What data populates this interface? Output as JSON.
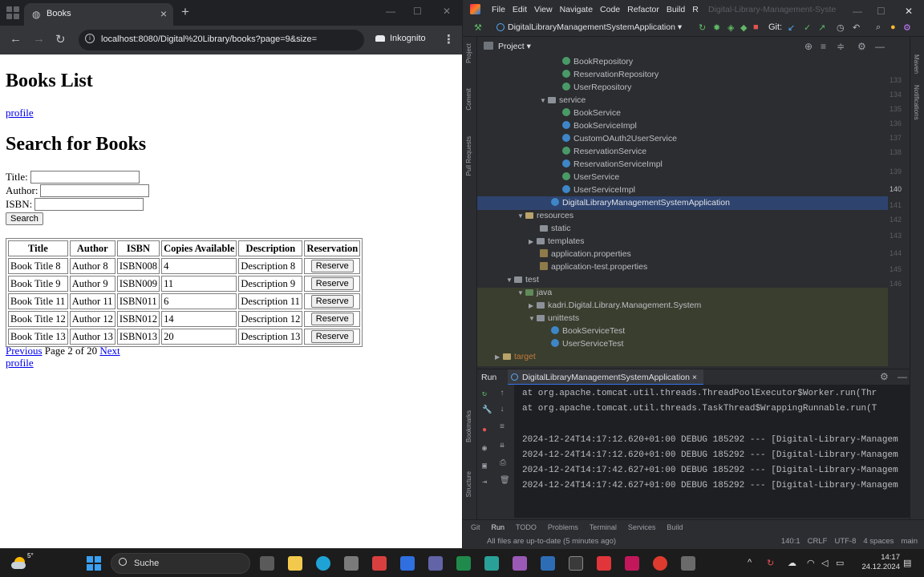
{
  "browser": {
    "tab_title": "Books",
    "url": "localhost:8080/Digital%20Library/books?page=9&size=",
    "incognito_label": "Inkognito"
  },
  "page": {
    "heading": "Books List",
    "profile_link": "profile",
    "search_heading": "Search for Books",
    "form": {
      "title_label": "Title:",
      "author_label": "Author:",
      "isbn_label": "ISBN:",
      "search_button": "Search"
    },
    "table": {
      "headers": [
        "Title",
        "Author",
        "ISBN",
        "Copies Available",
        "Description",
        "Reservation"
      ],
      "rows": [
        [
          "Book Title 8",
          "Author 8",
          "ISBN008",
          "4",
          "Description 8",
          "Reserve"
        ],
        [
          "Book Title 9",
          "Author 9",
          "ISBN009",
          "11",
          "Description 9",
          "Reserve"
        ],
        [
          "Book Title 11",
          "Author 11",
          "ISBN011",
          "6",
          "Description 11",
          "Reserve"
        ],
        [
          "Book Title 12",
          "Author 12",
          "ISBN012",
          "14",
          "Description 12",
          "Reserve"
        ],
        [
          "Book Title 13",
          "Author 13",
          "ISBN013",
          "20",
          "Description 13",
          "Reserve"
        ]
      ]
    },
    "pager": {
      "previous": "Previous",
      "info": "Page 2 of 20",
      "next": "Next"
    },
    "profile_link_bottom": "profile"
  },
  "ide": {
    "menu": [
      "File",
      "Edit",
      "View",
      "Navigate",
      "Code",
      "Refactor",
      "Build"
    ],
    "menu_extra": "R",
    "window_title": "Digital-Library-Management-Syste",
    "run_config": "DigitalLibraryManagementSystemApplication",
    "git_label": "Git:",
    "project_label": "Project",
    "tree": [
      {
        "label": "BookRepository",
        "kind": "iface"
      },
      {
        "label": "ReservationRepository",
        "kind": "iface"
      },
      {
        "label": "UserRepository",
        "kind": "iface"
      },
      {
        "label": "service",
        "kind": "folder"
      },
      {
        "label": "BookService",
        "kind": "iface"
      },
      {
        "label": "BookServiceImpl",
        "kind": "class"
      },
      {
        "label": "CustomOAuth2UserService",
        "kind": "class"
      },
      {
        "label": "ReservationService",
        "kind": "iface"
      },
      {
        "label": "ReservationServiceImpl",
        "kind": "class"
      },
      {
        "label": "UserService",
        "kind": "iface"
      },
      {
        "label": "UserServiceImpl",
        "kind": "class"
      },
      {
        "label": "DigitalLibraryManagementSystemApplication",
        "kind": "class"
      },
      {
        "label": "resources",
        "kind": "res"
      },
      {
        "label": "static",
        "kind": "folder"
      },
      {
        "label": "templates",
        "kind": "folder"
      },
      {
        "label": "application.properties",
        "kind": "props"
      },
      {
        "label": "application-test.properties",
        "kind": "props"
      },
      {
        "label": "test",
        "kind": "folder"
      },
      {
        "label": "java",
        "kind": "test"
      },
      {
        "label": "kadri.Digital.Library.Management.System",
        "kind": "folder"
      },
      {
        "label": "unittests",
        "kind": "folder"
      },
      {
        "label": "BookServiceTest",
        "kind": "class"
      },
      {
        "label": "UserServiceTest",
        "kind": "class"
      },
      {
        "label": "target",
        "kind": "res"
      }
    ],
    "gutter": [
      "133",
      "134",
      "135",
      "136",
      "137",
      "138",
      "139",
      "140",
      "141",
      "142",
      "143",
      "144",
      "145",
      "146"
    ],
    "run_label": "Run",
    "run_tab": "DigitalLibraryManagementSystemApplication",
    "console": [
      "    at org.apache.tomcat.util.threads.ThreadPoolExecutor$Worker.run(Thr",
      "    at org.apache.tomcat.util.threads.TaskThread$WrappingRunnable.run(T",
      "2024-12-24T14:17:12.620+01:00 DEBUG 185292 --- [Digital-Library-Managem",
      "2024-12-24T14:17:12.620+01:00 DEBUG 185292 --- [Digital-Library-Managem",
      "2024-12-24T14:17:42.627+01:00 DEBUG 185292 --- [Digital-Library-Managem",
      "2024-12-24T14:17:42.627+01:00 DEBUG 185292 --- [Digital-Library-Managem"
    ],
    "bottom_tabs": [
      "Git",
      "Run",
      "TODO",
      "Problems",
      "Terminal",
      "Services",
      "Build"
    ],
    "status_message": "All files are up-to-date (5 minutes ago)",
    "status_right": [
      "140:1",
      "CRLF",
      "UTF-8",
      "4 spaces",
      "main"
    ],
    "left_strip": [
      "Project",
      "Commit",
      "Pull Requests",
      "Bookmarks",
      "Structure"
    ],
    "right_strip": [
      "Maven",
      "Notifications"
    ]
  },
  "taskbar": {
    "weather_temp": "5°",
    "search_placeholder": "Suche",
    "time": "14:17",
    "date": "24.12.2024"
  }
}
